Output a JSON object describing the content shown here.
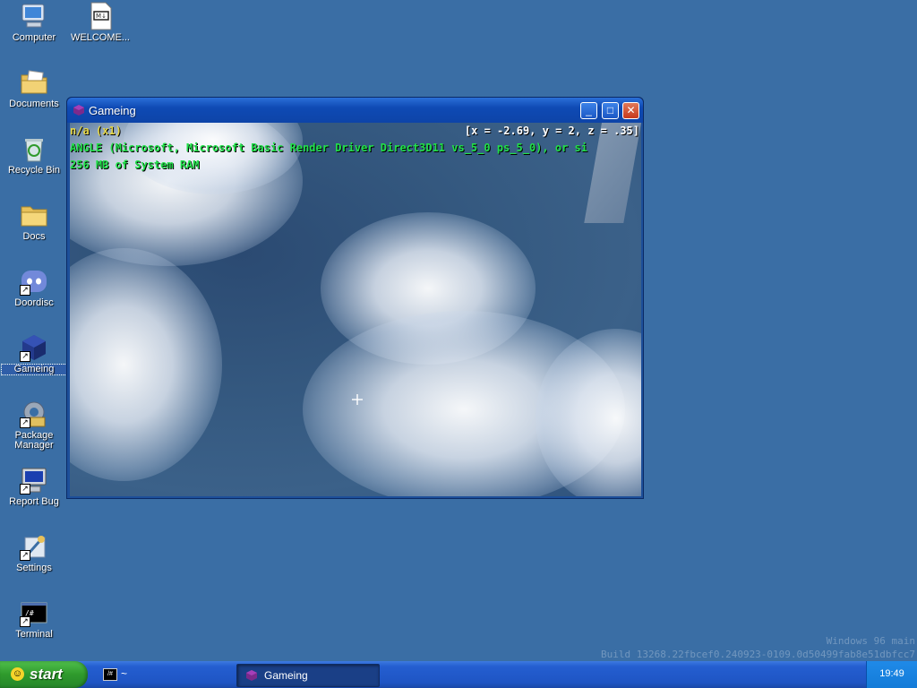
{
  "desktop": {
    "icons": [
      {
        "label": "Computer",
        "icon": "computer-icon"
      },
      {
        "label": "WELCOME...",
        "icon": "markdown-file-icon"
      },
      {
        "label": "Documents",
        "icon": "documents-folder-icon"
      },
      {
        "label": "Recycle Bin",
        "icon": "recycle-bin-icon"
      },
      {
        "label": "Docs",
        "icon": "folder-icon"
      },
      {
        "label": "Doordisc",
        "icon": "doordisc-icon"
      },
      {
        "label": "Gameing",
        "icon": "gameing-cube-icon"
      },
      {
        "label": "Package Manager",
        "icon": "package-manager-icon"
      },
      {
        "label": "Report Bug",
        "icon": "report-bug-icon"
      },
      {
        "label": "Settings",
        "icon": "settings-icon"
      },
      {
        "label": "Terminal",
        "icon": "terminal-icon"
      }
    ]
  },
  "window": {
    "title": "Gameing",
    "buttons": {
      "minimize": "_",
      "maximize": "□",
      "close": "✕"
    },
    "hud": {
      "mode": "n/a (x1)",
      "coords": "[x = -2.69, y = 2, z = .35]",
      "renderer": "ANGLE (Microsoft, Microsoft Basic Render Driver Direct3D11 vs_5_0 ps_5_0), or si",
      "memory": "256 MB of System RAM"
    }
  },
  "watermark": {
    "line1": "Windows 96 main",
    "line2": "Build 13268.22fbcef0.240923-0109.0d50499fab8e51dbfcc7"
  },
  "taskbar": {
    "start_label": "start",
    "terminal_task": "~",
    "game_task": "Gameing",
    "clock": "19:49"
  },
  "colors": {
    "desktop": "#3a6ea5",
    "hud_yellow": "#e4d64a",
    "hud_green": "#22e04a",
    "taskbar": "#245ed0",
    "start": "#2f9a2c"
  }
}
